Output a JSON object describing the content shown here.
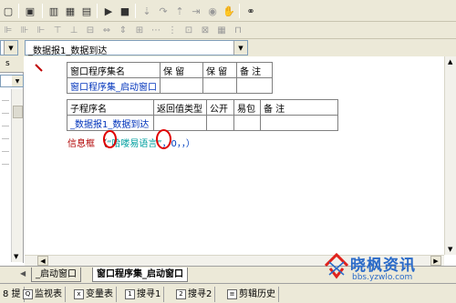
{
  "combo": {
    "value": "_数据报1_数据到达"
  },
  "left_panel": {
    "header": "s"
  },
  "table1": {
    "headers": [
      "窗口程序集名",
      "保 留",
      "保 留",
      "备 注"
    ],
    "row": [
      "窗口程序集_启动窗口",
      "",
      "",
      ""
    ]
  },
  "table2": {
    "headers": [
      "子程序名",
      "返回值类型",
      "公开",
      "易包",
      "备 注"
    ],
    "row": [
      "_数据报1_数据到达",
      "",
      "",
      "",
      ""
    ]
  },
  "code": {
    "keyword": "信息框",
    "open": "（",
    "string": "“哈喽易语言”",
    "args": "，0，，）"
  },
  "doc_tabs": [
    {
      "label": "_启动窗口"
    },
    {
      "label": "窗口程序集_启动窗口"
    }
  ],
  "status_tabs": [
    {
      "label": "8 提"
    },
    {
      "label": "监视表",
      "icon": "Q"
    },
    {
      "label": "变量表",
      "icon": "x"
    },
    {
      "label": "搜寻1",
      "icon": "1"
    },
    {
      "label": "搜寻2",
      "icon": "2"
    },
    {
      "label": "剪辑历史",
      "icon": "≡"
    }
  ],
  "watermark": {
    "name": "晓枫资讯",
    "url": "bbs.yzwlo.com"
  },
  "colors": {
    "accent_red": "#e00000",
    "link_blue": "#0033bb"
  }
}
